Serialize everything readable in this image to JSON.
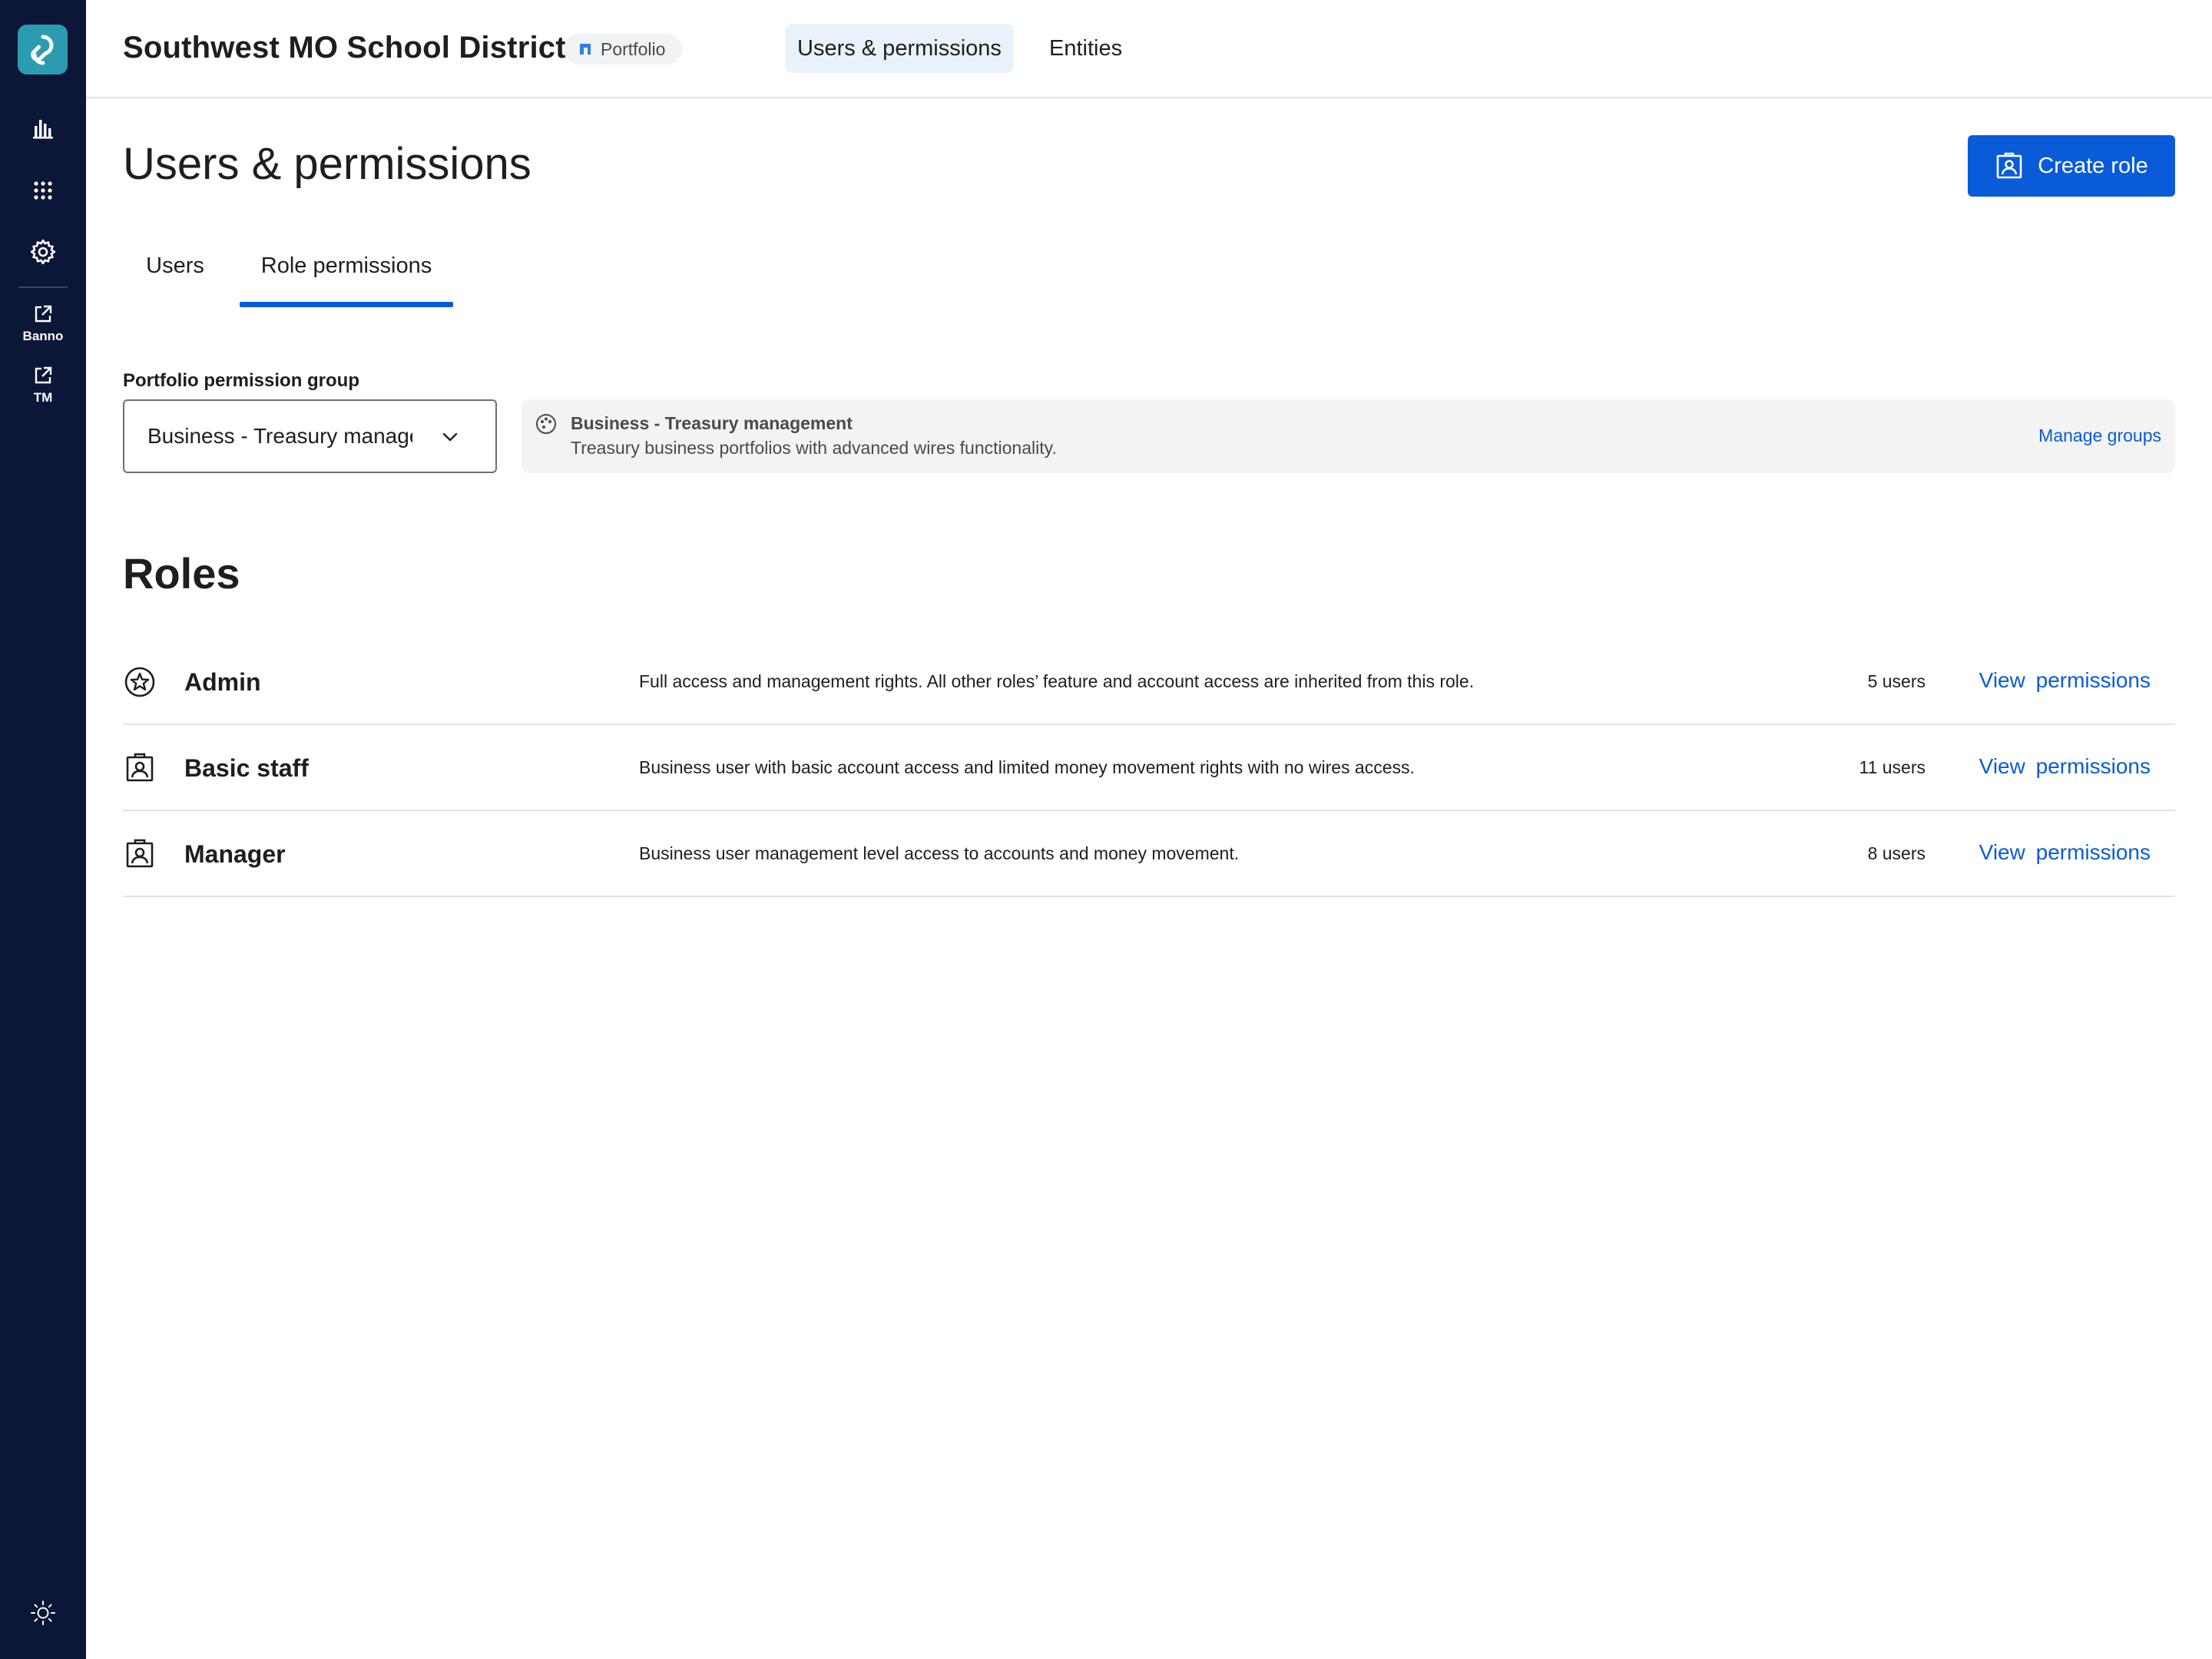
{
  "rail": {
    "items": [
      {
        "name": "reports",
        "icon": "bar-chart-icon"
      },
      {
        "name": "apps",
        "icon": "grid-icon"
      },
      {
        "name": "settings",
        "icon": "gear-icon"
      }
    ],
    "external": [
      {
        "label": "Banno",
        "icon": "external-link-icon"
      },
      {
        "label": "TM",
        "icon": "external-link-icon"
      }
    ],
    "theme_icon": "sun-icon"
  },
  "header": {
    "org_title": "Southwest MO School District",
    "portfolio_badge": "Portfolio",
    "nav": [
      {
        "label": "Users & permissions",
        "active": true
      },
      {
        "label": "Entities",
        "active": false
      }
    ]
  },
  "page": {
    "title": "Users & permissions",
    "create_role_label": "Create role",
    "tabs": [
      {
        "label": "Users",
        "active": false
      },
      {
        "label": "Role permissions",
        "active": true
      }
    ]
  },
  "permission_group": {
    "label": "Portfolio permission group",
    "selected": "Business - Treasury management",
    "info_title": "Business - Treasury management",
    "info_description": "Treasury business portfolios with advanced wires functionality.",
    "manage_link": "Manage groups"
  },
  "roles": {
    "title": "Roles",
    "view_label": "View  permissions",
    "items": [
      {
        "name": "Admin",
        "icon": "star-badge-icon",
        "description": "Full access and management rights. All other roles’ feature and account access are inherited from this role.",
        "count": "5 users"
      },
      {
        "name": "Basic staff",
        "icon": "id-badge-icon",
        "description": "Business user with basic account access and limited money movement rights with no wires access.",
        "count": "11 users"
      },
      {
        "name": "Manager",
        "icon": "id-badge-icon",
        "description": "Business user management level access to accounts and money movement.",
        "count": "8 users"
      }
    ]
  },
  "colors": {
    "rail_bg": "#0c1637",
    "accent": "#0a5bd8",
    "logo_bg": "#2a9bb0",
    "nav_active_bg": "#e9f1fd"
  }
}
